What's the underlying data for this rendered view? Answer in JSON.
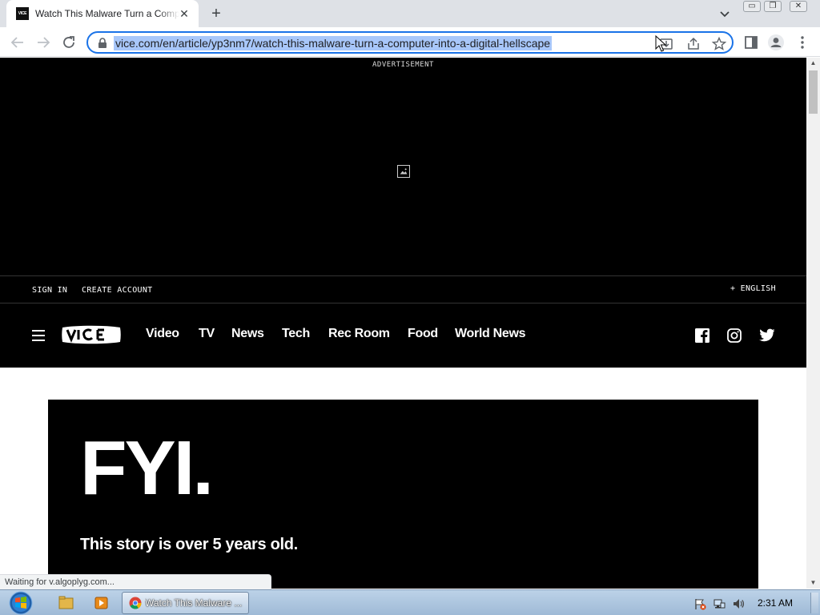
{
  "browser": {
    "tab": {
      "title": "Watch This Malware Turn a Computer into a Digital Hellscape",
      "favicon_text": "VICE"
    },
    "new_tab_label": "+",
    "url": "vice.com/en/article/yp3nm7/watch-this-malware-turn-a-computer-into-a-digital-hellscape",
    "status_text": "Waiting for v.algoplyg.com..."
  },
  "page": {
    "ad_label": "ADVERTISEMENT",
    "account": {
      "sign_in": "SIGN IN",
      "create_account": "CREATE ACCOUNT",
      "language": "+ ENGLISH"
    },
    "nav": {
      "items": [
        "Video",
        "TV",
        "News",
        "Tech",
        "Rec Room",
        "Food",
        "World News"
      ]
    },
    "article": {
      "headline": "FYI.",
      "note": "This story is over 5 years old."
    }
  },
  "taskbar": {
    "task_label": "Watch This Malware ...",
    "clock": "2:31 AM"
  },
  "colors": {
    "accent": "#1a73e8",
    "url_highlight": "#a8c7fa",
    "page_bg": "#000000",
    "tab_strip": "#dee1e6"
  }
}
